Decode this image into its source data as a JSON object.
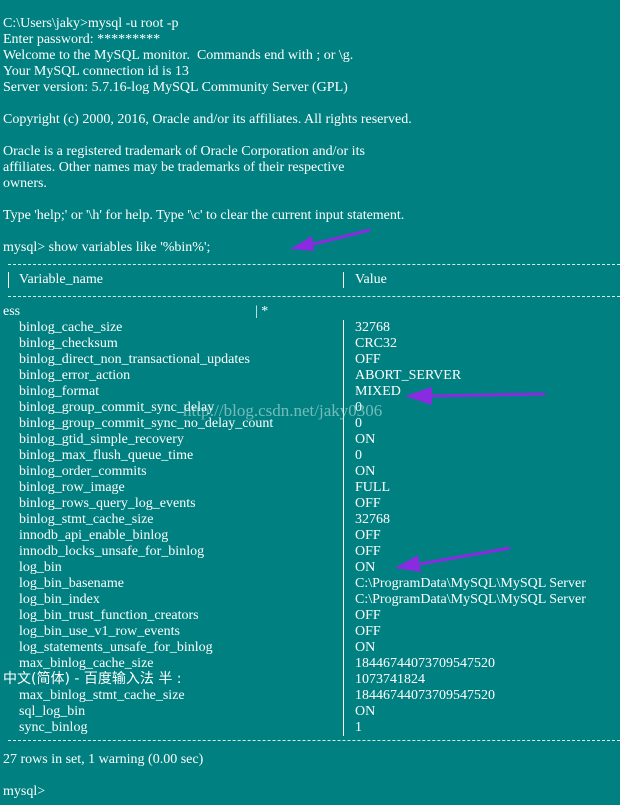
{
  "terminal": {
    "header_lines": [
      "C:\\Users\\jaky>mysql -u root -p",
      "Enter password: *********",
      "Welcome to the MySQL monitor.  Commands end with ; or \\g.",
      "Your MySQL connection id is 13",
      "Server version: 5.7.16-log MySQL Community Server (GPL)",
      "",
      "Copyright (c) 2000, 2016, Oracle and/or its affiliates. All rights reserved.",
      "",
      "Oracle is a registered trademark of Oracle Corporation and/or its",
      "affiliates. Other names may be trademarks of their respective",
      "owners.",
      "",
      "Type 'help;' or '\\h' for help. Type '\\c' to clear the current input statement."
    ],
    "command_line": "mysql> show variables like '%bin%';",
    "table": {
      "header_name": "Variable_name",
      "header_value": "Value",
      "artifact_left": "ess",
      "artifact_mid": "| *",
      "rows": [
        {
          "name": "binlog_cache_size",
          "value": "32768"
        },
        {
          "name": "binlog_checksum",
          "value": "CRC32"
        },
        {
          "name": "binlog_direct_non_transactional_updates",
          "value": "OFF"
        },
        {
          "name": "binlog_error_action",
          "value": "ABORT_SERVER"
        },
        {
          "name": "binlog_format",
          "value": "MIXED"
        },
        {
          "name": "binlog_group_commit_sync_delay",
          "value": "0"
        },
        {
          "name": "binlog_group_commit_sync_no_delay_count",
          "value": "0"
        },
        {
          "name": "binlog_gtid_simple_recovery",
          "value": "ON"
        },
        {
          "name": "binlog_max_flush_queue_time",
          "value": "0"
        },
        {
          "name": "binlog_order_commits",
          "value": "ON"
        },
        {
          "name": "binlog_row_image",
          "value": "FULL"
        },
        {
          "name": "binlog_rows_query_log_events",
          "value": "OFF"
        },
        {
          "name": "binlog_stmt_cache_size",
          "value": "32768"
        },
        {
          "name": "innodb_api_enable_binlog",
          "value": "OFF"
        },
        {
          "name": "innodb_locks_unsafe_for_binlog",
          "value": "OFF"
        },
        {
          "name": "log_bin",
          "value": "ON"
        },
        {
          "name": "log_bin_basename",
          "value": "C:\\ProgramData\\MySQL\\MySQL Server"
        },
        {
          "name": "log_bin_index",
          "value": "C:\\ProgramData\\MySQL\\MySQL Server"
        },
        {
          "name": "log_bin_trust_function_creators",
          "value": "OFF"
        },
        {
          "name": "log_bin_use_v1_row_events",
          "value": "OFF"
        },
        {
          "name": "log_statements_unsafe_for_binlog",
          "value": "ON"
        },
        {
          "name": "max_binlog_cache_size",
          "value": "18446744073709547520"
        },
        {
          "name": "",
          "value": "1073741824"
        },
        {
          "name": "max_binlog_stmt_cache_size",
          "value": "18446744073709547520"
        },
        {
          "name": "sql_log_bin",
          "value": "ON"
        },
        {
          "name": "sync_binlog",
          "value": "1"
        }
      ]
    },
    "result_line": "27 rows in set, 1 warning (0.00 sec)",
    "prompt_line": "mysql>"
  },
  "watermark": "http://blog.csdn.net/jaky0306",
  "ime_bar": "中文(简体) - 百度输入法 半 :",
  "colors": {
    "background": "#008080",
    "text": "#ffffff",
    "arrow": "#8a2be2"
  }
}
